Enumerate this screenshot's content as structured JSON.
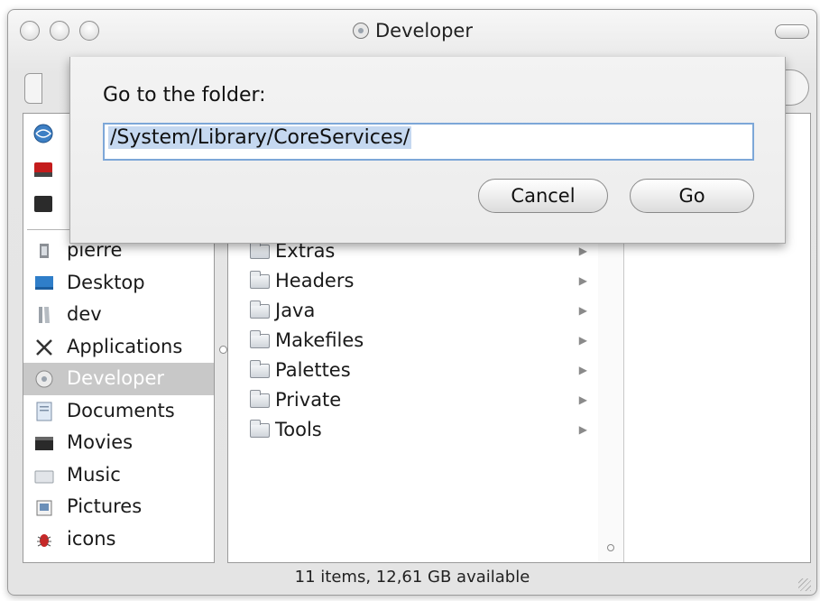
{
  "window": {
    "title": "Developer"
  },
  "sidebar": {
    "places": [
      {
        "label": "pierre",
        "icon": "home-icon",
        "selected": false
      },
      {
        "label": "Desktop",
        "icon": "desktop-icon",
        "selected": false
      },
      {
        "label": "dev",
        "icon": "folder-icon",
        "selected": false
      },
      {
        "label": "Applications",
        "icon": "applications-icon",
        "selected": false
      },
      {
        "label": "Developer",
        "icon": "disk-icon",
        "selected": true
      },
      {
        "label": "Documents",
        "icon": "documents-icon",
        "selected": false
      },
      {
        "label": "Movies",
        "icon": "movies-icon",
        "selected": false
      },
      {
        "label": "Music",
        "icon": "music-icon",
        "selected": false
      },
      {
        "label": "Pictures",
        "icon": "pictures-icon",
        "selected": false
      },
      {
        "label": "icons",
        "icon": "bug-icon",
        "selected": false
      }
    ]
  },
  "browser": {
    "folders": [
      {
        "label": "Extras"
      },
      {
        "label": "Headers"
      },
      {
        "label": "Java"
      },
      {
        "label": "Makefiles"
      },
      {
        "label": "Palettes"
      },
      {
        "label": "Private"
      },
      {
        "label": "Tools"
      }
    ]
  },
  "status": {
    "text": "11 items, 12,61 GB available"
  },
  "goto_sheet": {
    "prompt": "Go to the folder:",
    "path": "/System/Library/CoreServices/",
    "cancel_label": "Cancel",
    "go_label": "Go"
  },
  "colors": {
    "selection": "#c8c8c8",
    "focus_ring": "#7da7d8",
    "text_highlight": "#c5d8f0"
  }
}
